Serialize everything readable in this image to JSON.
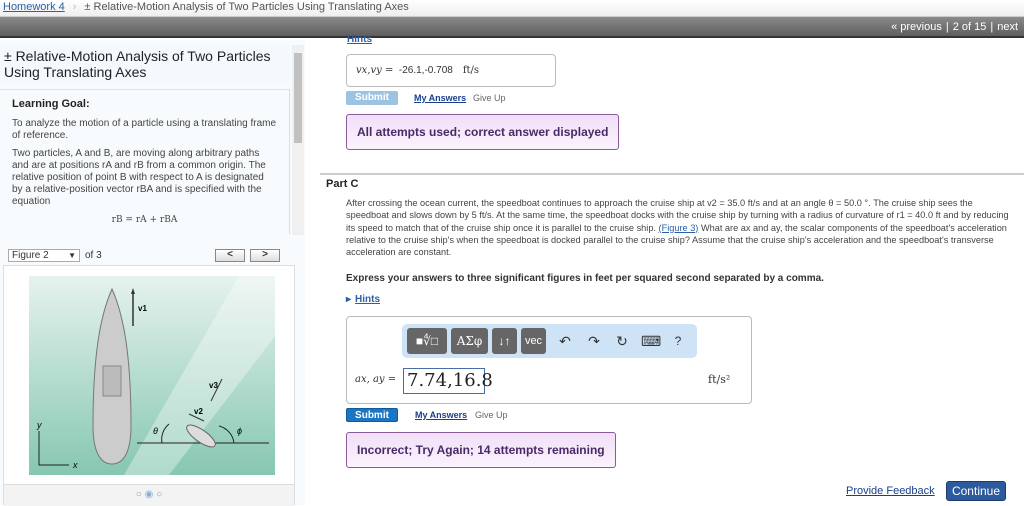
{
  "breadcrumb": {
    "home": "Homework 4",
    "title": "± Relative-Motion Analysis of Two Particles Using Translating Axes"
  },
  "nav": {
    "previous": "« previous",
    "position": "2 of 15",
    "next": "next"
  },
  "intro": {
    "title": "± Relative-Motion Analysis of Two Particles Using Translating Axes",
    "goal_label": "Learning Goal:",
    "goal_text": "To analyze the motion of a particle using a translating frame of reference.",
    "para": "Two particles, A and B, are moving along arbitrary paths and are at positions rA and rB from a common origin. The relative position of point B with respect to A is designated by a relative-position vector rBA and is specified with the equation",
    "equation": "rB = rA + rBA"
  },
  "figure": {
    "selected": "Figure 2",
    "of": "of 3",
    "prev": "<",
    "next": ">",
    "labels": {
      "v1": "v1",
      "v2": "v2",
      "v3": "v3",
      "theta": "θ",
      "phi": "ϕ",
      "x": "x",
      "y": "y"
    },
    "dots": [
      "○",
      "◉",
      "○"
    ]
  },
  "part_b": {
    "hints": "Hints",
    "label": "vx,vy =",
    "value": "-26.1,-0.708",
    "unit": "ft/s",
    "submit": "Submit",
    "my_answers": "My Answers",
    "give_up": "Give Up",
    "message": "All attempts used; correct answer displayed"
  },
  "part_c": {
    "title": "Part C",
    "q1": "After crossing the ocean current, the speedboat continues to approach the cruise ship at v2 = 35.0 ft/s and at an angle θ = 50.0 °. The cruise ship sees the speedboat and slows down by 5 ft/s. At the same time, the speedboat docks with the cruise ship by turning with a radius of curvature of r1 = 40.0 ft and by reducing its speed to match that of the cruise ship once it is parallel to the cruise ship.",
    "fig_link": "(Figure 3)",
    "q2": "What are ax and ay, the scalar components of the speedboat's acceleration relative to the cruise ship's when the speedboat is docked parallel to the cruise ship? Assume that the cruise ship's acceleration and the speedboat's transverse acceleration are constant.",
    "express": "Express your answers to three significant figures in feet per squared second separated by a comma.",
    "hints": "Hints",
    "toolbar": {
      "templates": "■∜□",
      "greek": "ΑΣφ",
      "arrows": "↓↑",
      "vec": "vec",
      "undo": "↶",
      "redo": "↷",
      "reset": "↻",
      "keyboard": "⌨",
      "help": "?"
    },
    "label": "ax, ay =",
    "value": "7.74,16.8",
    "unit": "ft/s²",
    "submit": "Submit",
    "my_answers": "My Answers",
    "give_up": "Give Up",
    "message": "Incorrect; Try Again; 14 attempts remaining"
  },
  "footer": {
    "feedback": "Provide Feedback",
    "continue": "Continue"
  },
  "colors": {
    "submit": "#1a76c4",
    "submit_disabled": "#9dc3e2",
    "continue": "#2c5a9c",
    "message_bg": "#f1dff8"
  }
}
